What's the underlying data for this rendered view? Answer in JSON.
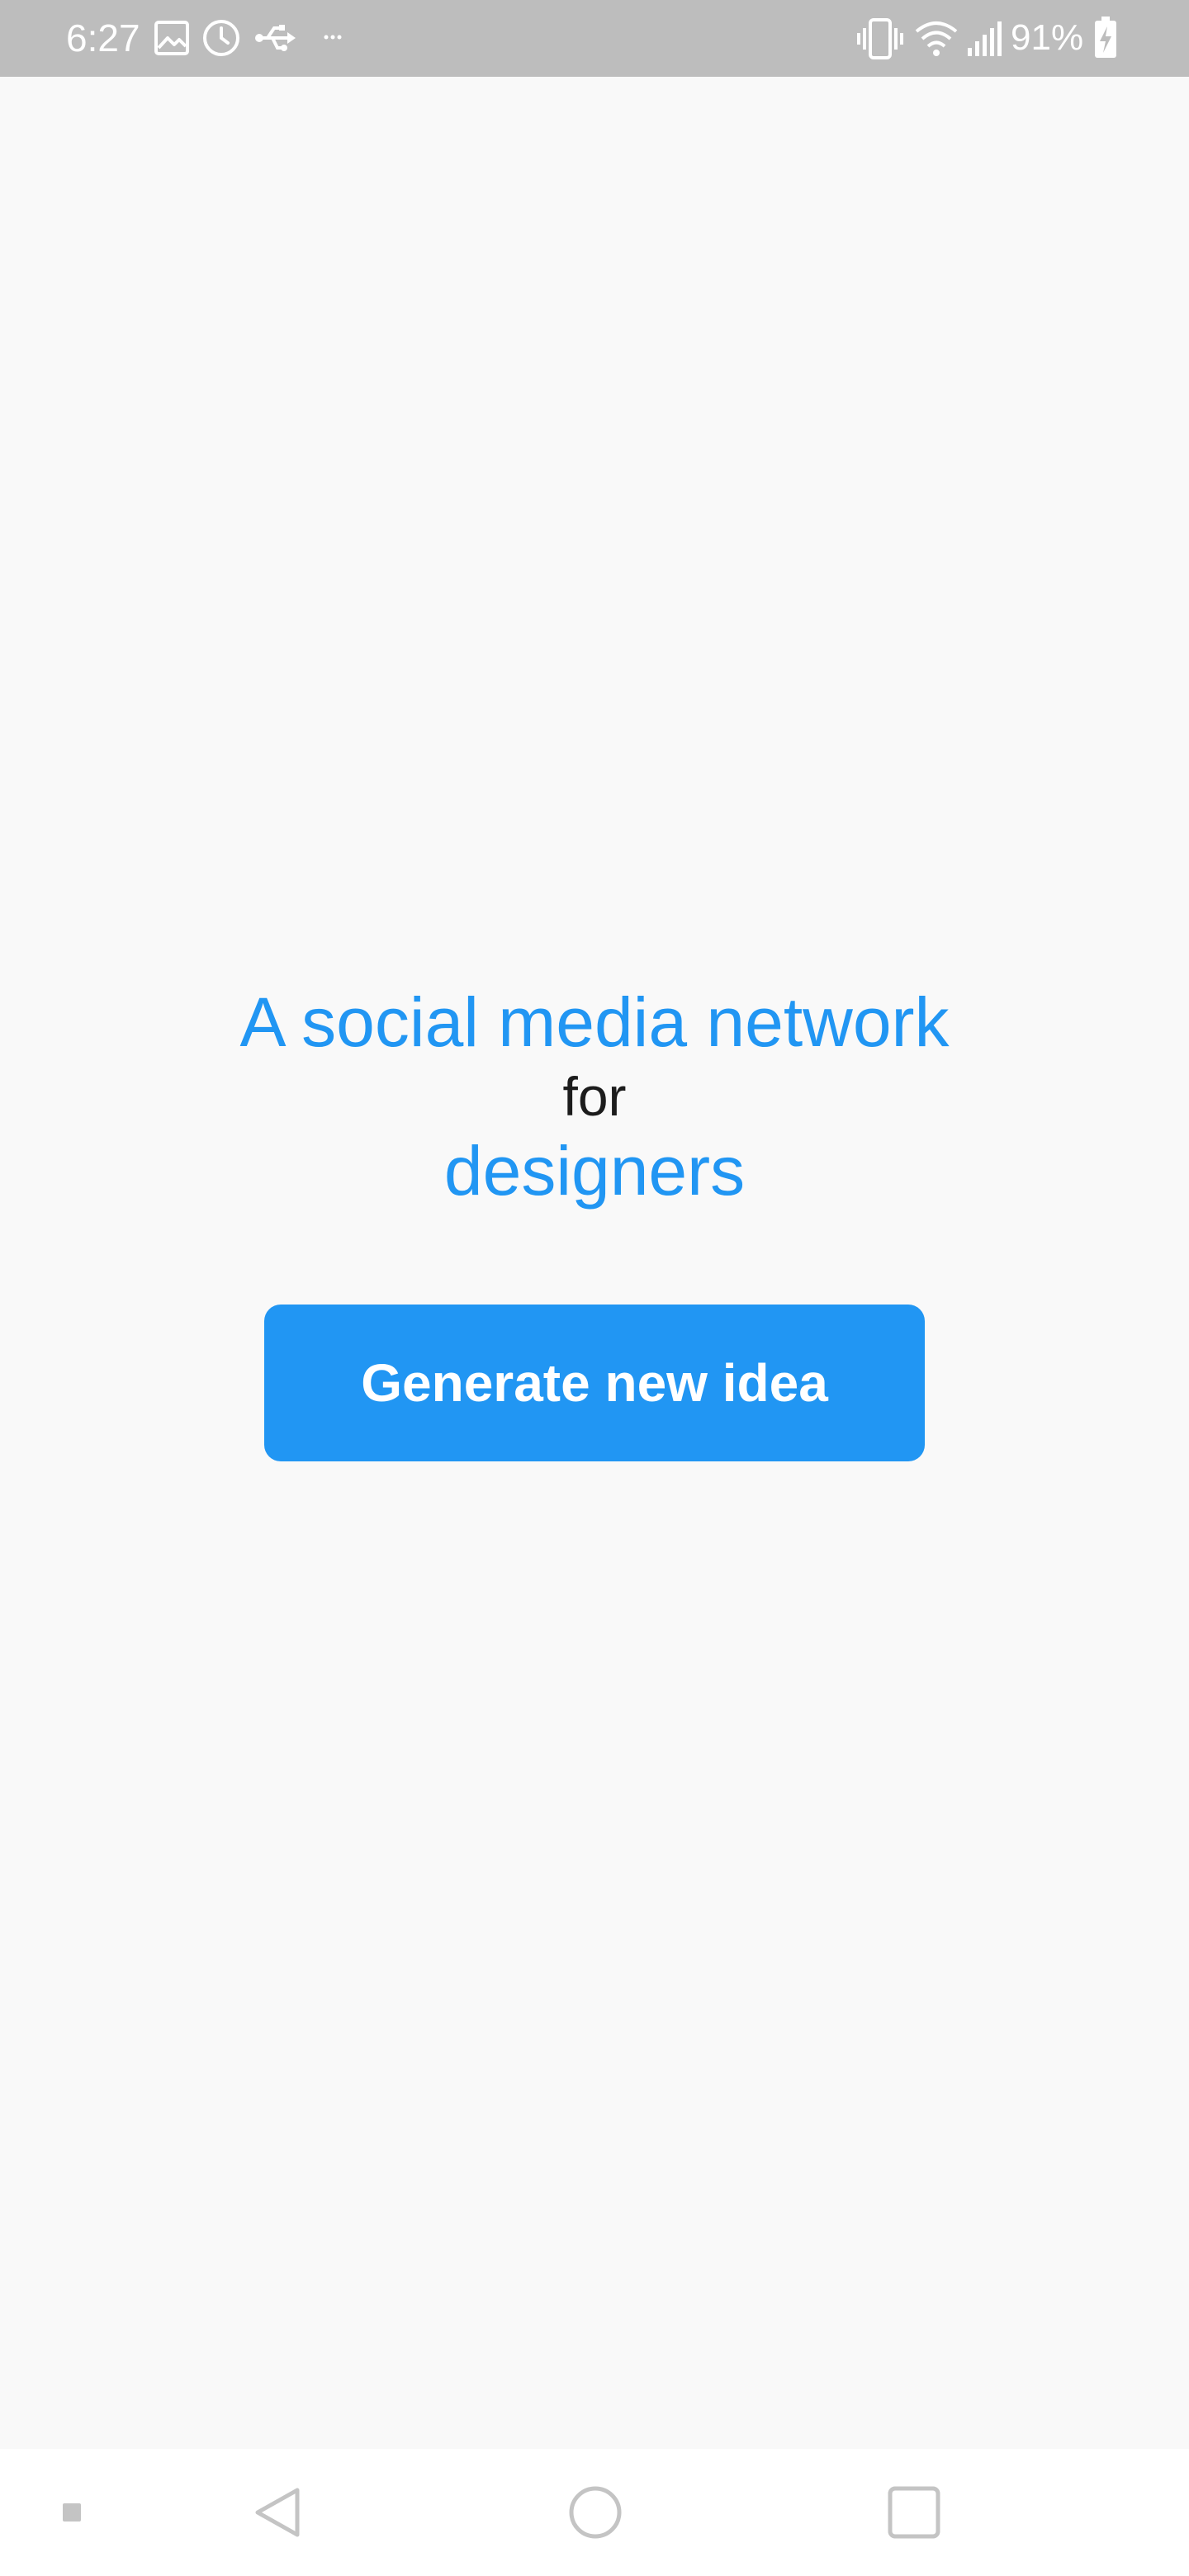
{
  "status_bar": {
    "time": "6:27",
    "battery_percent": "91%",
    "icons_left": [
      "image-icon",
      "clock-icon",
      "usb-icon",
      "more-dots-icon"
    ],
    "icons_right": [
      "vibrate-icon",
      "wifi-icon",
      "signal-icon",
      "battery-charging-icon"
    ]
  },
  "main": {
    "headline_line1": "A social media network",
    "headline_line2": "for",
    "headline_line3": "designers",
    "generate_button_label": "Generate new idea"
  },
  "nav_bar": {
    "icons": [
      "recents-dot-icon",
      "back-icon",
      "home-icon",
      "overview-icon"
    ]
  },
  "colors": {
    "accent": "#2196f3",
    "status_bar_bg": "#bdbdbd",
    "background": "#f9f9f9",
    "text_dark": "#1c1c1c"
  }
}
